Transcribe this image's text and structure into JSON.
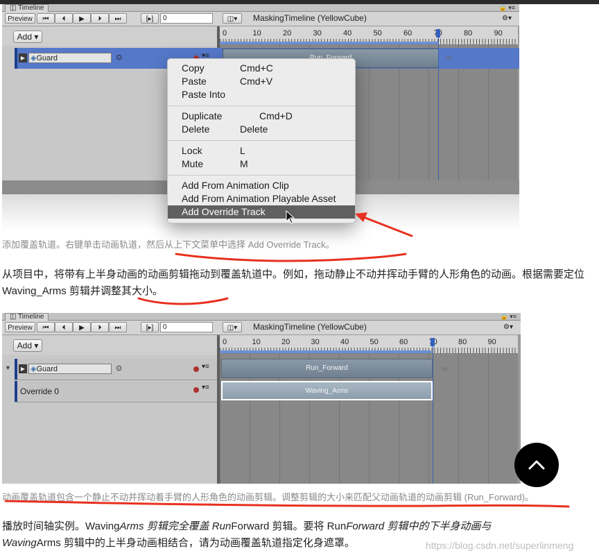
{
  "panel1": {
    "tab_label": "Timeline",
    "preview_label": "Preview",
    "time_value": "0",
    "seq_name": "MaskingTimeline (YellowCube)",
    "add_label": "Add",
    "track_name": "Guard",
    "clip_label": "Run_Forward",
    "ruler": [
      "0",
      "10",
      "20",
      "30",
      "40",
      "50",
      "60",
      "70",
      "80",
      "90"
    ]
  },
  "context_menu": {
    "items": [
      {
        "label": "Copy",
        "shortcut": "Cmd+C"
      },
      {
        "label": "Paste",
        "shortcut": "Cmd+V"
      },
      {
        "label": "Paste Into",
        "shortcut": ""
      },
      {
        "label": "Duplicate",
        "shortcut": "Cmd+D"
      },
      {
        "label": "Delete",
        "shortcut": "Delete"
      },
      {
        "label": "Lock",
        "shortcut": "L"
      },
      {
        "label": "Mute",
        "shortcut": "M"
      },
      {
        "label": "Add From Animation Clip",
        "shortcut": ""
      },
      {
        "label": "Add From Animation Playable Asset",
        "shortcut": ""
      },
      {
        "label": "Add Override Track",
        "shortcut": ""
      }
    ]
  },
  "caption1": "添加覆盖轨道。右键单击动画轨道，然后从上下文菜单中选择 Add Override Track。",
  "paragraph1": "从项目中，将带有上半身动画的动画剪辑拖动到覆盖轨道中。例如，拖动静止不动并挥动手臂的人形角色的动画。根据需要定位 Waving_Arms 剪辑并调整其大小。",
  "panel2": {
    "tab_label": "Timeline",
    "preview_label": "Preview",
    "time_value": "0",
    "seq_name": "MaskingTimeline (YellowCube)",
    "add_label": "Add",
    "track_name": "Guard",
    "override_name": "Override 0",
    "clip1_label": "Run_Forward",
    "clip2_label": "Waving_Arms",
    "ruler": [
      "0",
      "10",
      "20",
      "30",
      "40",
      "50",
      "60",
      "70",
      "80",
      "90"
    ]
  },
  "caption2": "动画覆盖轨道包含一个静止不动并挥动着手臂的人形角色的动画剪辑。调整剪辑的大小来匹配父动画轨道的动画剪辑 (Run_Forward)。",
  "paragraph2": {
    "line1_a": "播放时间轴实例。Waving",
    "line1_b": "Arms 剪辑完全覆盖 Run",
    "line1_c": "Forward 剪辑。要将 Run",
    "line1_d": "Forward 剪辑中的下半身动画与",
    "line2_a": "Waving",
    "line2_b": "Arms 剪辑中的上半身动画相结合，请为动画覆盖轨道指定化身遮罩。"
  },
  "watermark": "https://blog.csdn.net/superlinmeng",
  "colors": {
    "accent": "#3660c0",
    "highlight_red": "#e8301f",
    "menu_highlight": "#606060"
  }
}
